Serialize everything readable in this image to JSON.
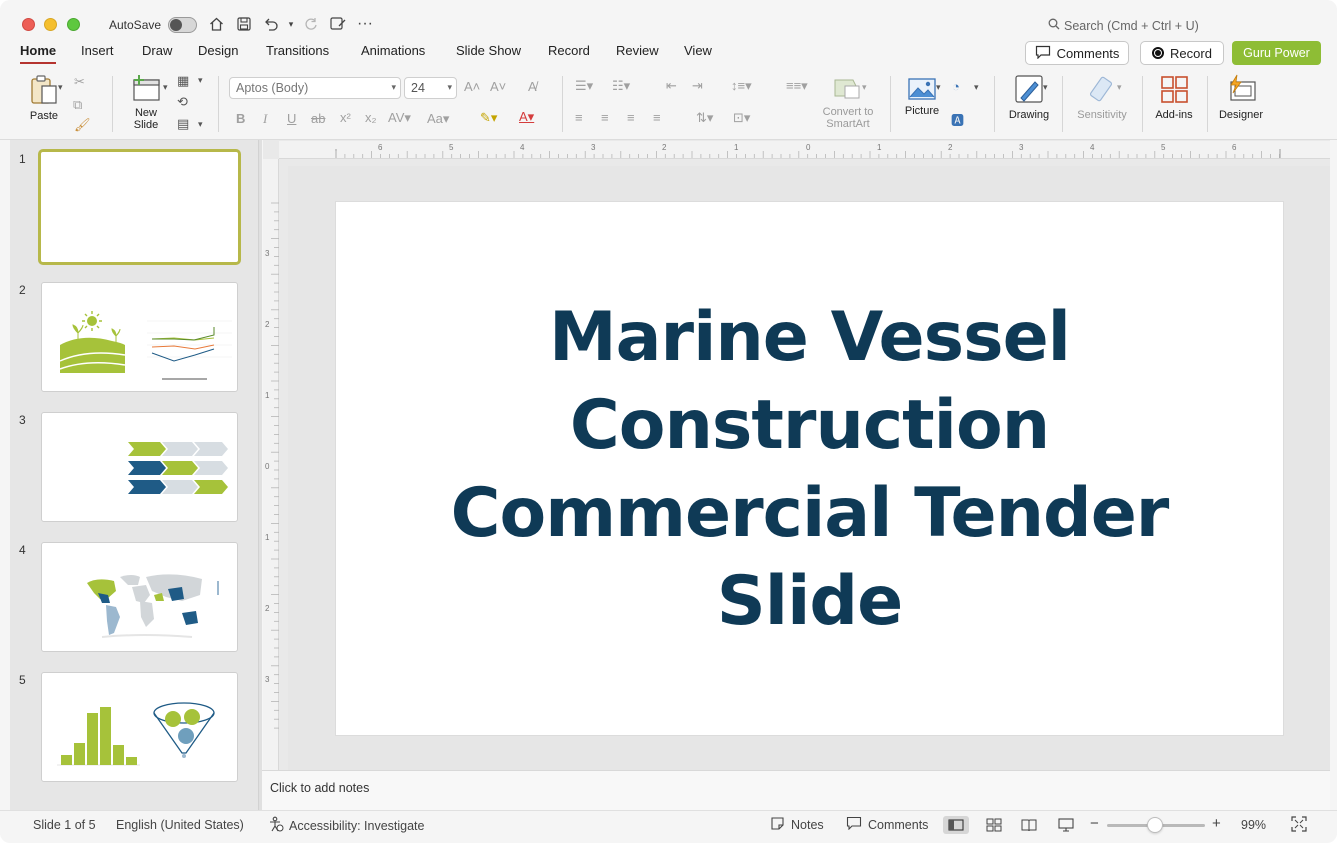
{
  "window": {
    "autosave_label": "AutoSave",
    "search_placeholder": "Search (Cmd + Ctrl + U)"
  },
  "tabs": [
    {
      "label": "Home",
      "active": true
    },
    {
      "label": "Insert"
    },
    {
      "label": "Draw"
    },
    {
      "label": "Design"
    },
    {
      "label": "Transitions"
    },
    {
      "label": "Animations"
    },
    {
      "label": "Slide Show"
    },
    {
      "label": "Record"
    },
    {
      "label": "Review"
    },
    {
      "label": "View"
    }
  ],
  "header_buttons": {
    "comments": "Comments",
    "record": "Record",
    "guru": "Guru Power"
  },
  "ribbon": {
    "paste": "Paste",
    "new_slide_line1": "New",
    "new_slide_line2": "Slide",
    "font_name": "Aptos (Body)",
    "font_size": "24",
    "convert_line1": "Convert to",
    "convert_line2": "SmartArt",
    "picture": "Picture",
    "drawing": "Drawing",
    "sensitivity": "Sensitivity",
    "addins": "Add-ins",
    "designer": "Designer"
  },
  "slides": [
    {
      "number": "1"
    },
    {
      "number": "2"
    },
    {
      "number": "3"
    },
    {
      "number": "4"
    },
    {
      "number": "5"
    }
  ],
  "slide": {
    "title": "Marine Vessel Construction Commercial Tender Slide"
  },
  "notes_placeholder": "Click to add notes",
  "status": {
    "slide_position": "Slide 1 of 5",
    "language": "English (United States)",
    "accessibility": "Accessibility: Investigate",
    "notes": "Notes",
    "comments": "Comments",
    "zoom": "99%"
  },
  "colors": {
    "accent_green": "#8ebd35",
    "title_navy": "#0f3a56",
    "tab_underline": "#b5342f"
  }
}
